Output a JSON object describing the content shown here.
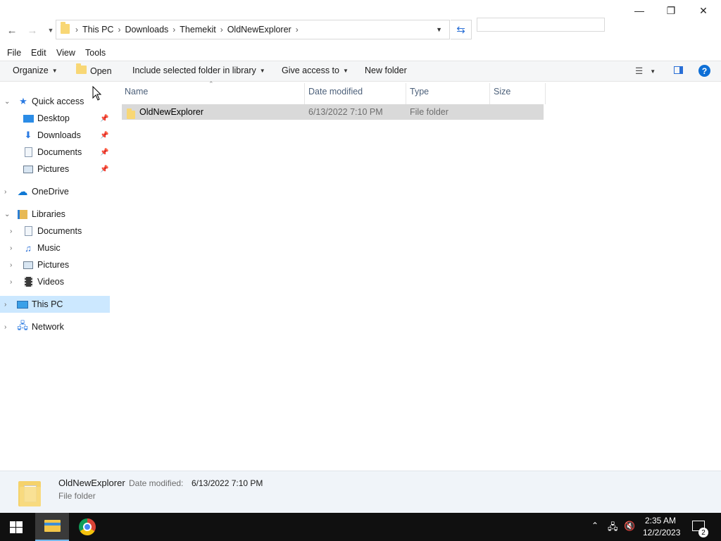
{
  "window": {
    "breadcrumb": [
      "This PC",
      "Downloads",
      "Themekit",
      "OldNewExplorer"
    ],
    "search_placeholder": "",
    "controls": {
      "minimize": "—",
      "maximize": "❐",
      "close": "✕"
    }
  },
  "menu": [
    "File",
    "Edit",
    "View",
    "Tools"
  ],
  "commands": {
    "organize": "Organize",
    "open": "Open",
    "include": "Include selected folder in library",
    "give_access": "Give access to",
    "new_folder": "New folder"
  },
  "nav": {
    "quick_access": "Quick access",
    "quick_items": [
      "Desktop",
      "Downloads",
      "Documents",
      "Pictures"
    ],
    "onedrive": "OneDrive",
    "libraries": "Libraries",
    "library_items": [
      "Documents",
      "Music",
      "Pictures",
      "Videos"
    ],
    "this_pc": "This PC",
    "network": "Network"
  },
  "columns": [
    "Name",
    "Date modified",
    "Type",
    "Size"
  ],
  "files": [
    {
      "name": "OldNewExplorer",
      "date": "6/13/2022 7:10 PM",
      "type": "File folder",
      "size": ""
    }
  ],
  "details": {
    "name": "OldNewExplorer",
    "date_label": "Date modified:",
    "date_value": "6/13/2022 7:10 PM",
    "type": "File folder"
  },
  "taskbar": {
    "time": "2:35 AM",
    "date": "12/2/2023",
    "notification_count": "2"
  },
  "colors": {
    "selection": "#d9d9d9",
    "nav_selected": "#cce8ff",
    "accent": "#0078d7"
  }
}
